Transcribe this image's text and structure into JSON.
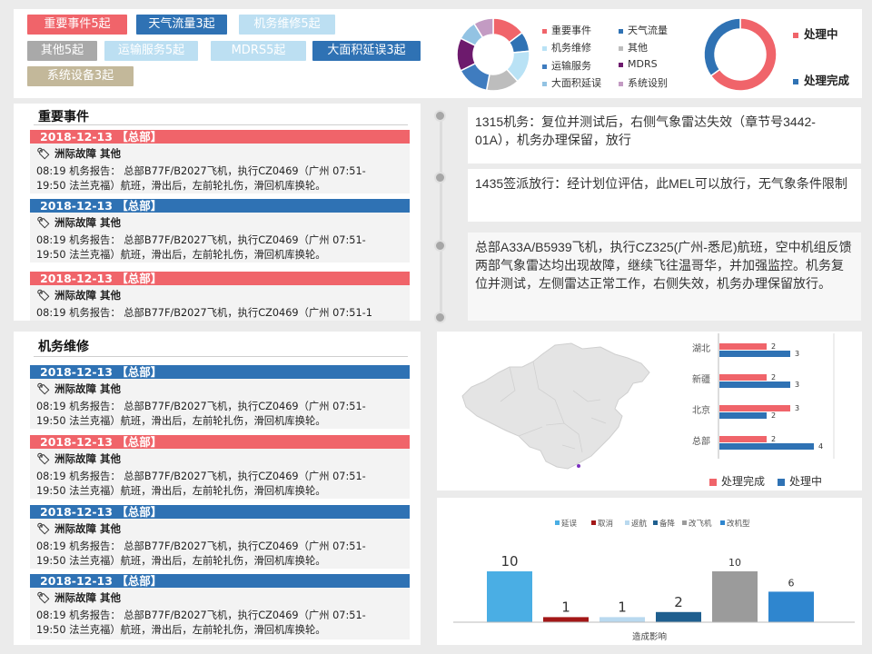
{
  "tags": [
    {
      "label": "重要事件5起",
      "color": "#f0646a"
    },
    {
      "label": "天气流量3起",
      "color": "#2f72b4"
    },
    {
      "label": "机务维修5起",
      "color": "#bcdff2"
    },
    {
      "label": "其他5起",
      "color": "#a9a9a9"
    },
    {
      "label": "运输服务5起",
      "color": "#bcdff2"
    },
    {
      "label": "MDRS5起",
      "color": "#bcdff2"
    },
    {
      "label": "大面积延误3起",
      "color": "#2f72b4"
    },
    {
      "label": "系统设备3起",
      "color": "#c3b89a"
    }
  ],
  "category_donut": {
    "legend": [
      {
        "label": "重要事件",
        "color": "#f0646a"
      },
      {
        "label": "天气流量",
        "color": "#2f72b4"
      },
      {
        "label": "机务维修",
        "color": "#b9e2f5"
      },
      {
        "label": "其他",
        "color": "#bdbdbd"
      },
      {
        "label": "运输服务",
        "color": "#3f7cbf"
      },
      {
        "label": "MDRS",
        "color": "#6d1a6d"
      },
      {
        "label": "大面积延误",
        "color": "#93c3e3"
      },
      {
        "label": "系统设别",
        "color": "#c39bc3"
      }
    ],
    "values": [
      5,
      3,
      5,
      5,
      5,
      5,
      3,
      3
    ]
  },
  "status_donut": {
    "legend": [
      {
        "label": "处理中",
        "color": "#f0646a"
      },
      {
        "label": "处理完成",
        "color": "#2f72b4"
      }
    ],
    "values": [
      65,
      35
    ]
  },
  "important_events": {
    "title": "重要事件",
    "items": [
      {
        "header": "2018-12-13 【总部】",
        "color": "#f0646a",
        "category": "洲际故障 其他",
        "text": "08:19 机务报告： 总部B77F/B2027飞机，执行CZ0469（广州 07:51-19:50 法兰克福）航班，滑出后，左前轮扎伤，滑回机库换轮。"
      },
      {
        "header": "2018-12-13 【总部】",
        "color": "#2f72b4",
        "category": "洲际故障 其他",
        "text": "08:19 机务报告： 总部B77F/B2027飞机，执行CZ0469（广州 07:51-19:50 法兰克福）航班，滑出后，左前轮扎伤，滑回机库换轮。"
      },
      {
        "header": "2018-12-13 【总部】",
        "color": "#f0646a",
        "category": "洲际故障 其他",
        "text": "08:19 机务报告： 总部B77F/B2027飞机，执行CZ0469（广州 07:51-1"
      }
    ]
  },
  "maintenance": {
    "title": "机务维修",
    "items": [
      {
        "header": "2018-12-13 【总部】",
        "color": "#2f72b4",
        "category": "洲际故障 其他",
        "text": "08:19 机务报告： 总部B77F/B2027飞机，执行CZ0469（广州 07:51-19:50 法兰克福）航班，滑出后，左前轮扎伤，滑回机库换轮。"
      },
      {
        "header": "2018-12-13 【总部】",
        "color": "#f0646a",
        "category": "洲际故障 其他",
        "text": "08:19 机务报告： 总部B77F/B2027飞机，执行CZ0469（广州 07:51-19:50 法兰克福）航班，滑出后，左前轮扎伤，滑回机库换轮。"
      },
      {
        "header": "2018-12-13 【总部】",
        "color": "#2f72b4",
        "category": "洲际故障 其他",
        "text": "08:19 机务报告： 总部B77F/B2027飞机，执行CZ0469（广州 07:51-19:50 法兰克福）航班，滑出后，左前轮扎伤，滑回机库换轮。"
      },
      {
        "header": "2018-12-13 【总部】",
        "color": "#2f72b4",
        "category": "洲际故障 其他",
        "text": "08:19 机务报告： 总部B77F/B2027飞机，执行CZ0469（广州 07:51-19:50 法兰克福）航班，滑出后，左前轮扎伤，滑回机库换轮。"
      }
    ]
  },
  "timeline": [
    {
      "text": "1315机务：复位并测试后，右侧气象雷达失效（章节号3442-01A），机务办理保留，放行"
    },
    {
      "text": "1435签派放行：经计划位评估，此MEL可以放行，无气象条件限制"
    },
    {
      "text": "总部A33A/B5939飞机，执行CZ325(广州-悉尼)航班，空中机组反馈两部气象雷达均出现故障，继续飞往温哥华，并加强监控。机务复位并测试，左侧雷达正常工作，右侧失效，机务办理保留放行。"
    }
  ],
  "chart_data": [
    {
      "type": "bar",
      "orientation": "horizontal",
      "categories": [
        "湖北",
        "新疆",
        "北京",
        "总部"
      ],
      "series": [
        {
          "name": "处理完成",
          "color": "#f0646a",
          "values": [
            2,
            2,
            3,
            2
          ]
        },
        {
          "name": "处理中",
          "color": "#2f72b4",
          "values": [
            3,
            3,
            2,
            4
          ]
        }
      ]
    },
    {
      "type": "bar",
      "categories": [
        "延误",
        "取消",
        "返航",
        "备降",
        "改飞机",
        "改机型"
      ],
      "values": [
        10,
        1,
        1,
        2,
        10,
        6
      ],
      "colors": [
        "#4aaee4",
        "#a31717",
        "#b9d9ef",
        "#1f5f8f",
        "#9b9b9b",
        "#2f86cf"
      ],
      "xlabel": "造成影响"
    }
  ]
}
